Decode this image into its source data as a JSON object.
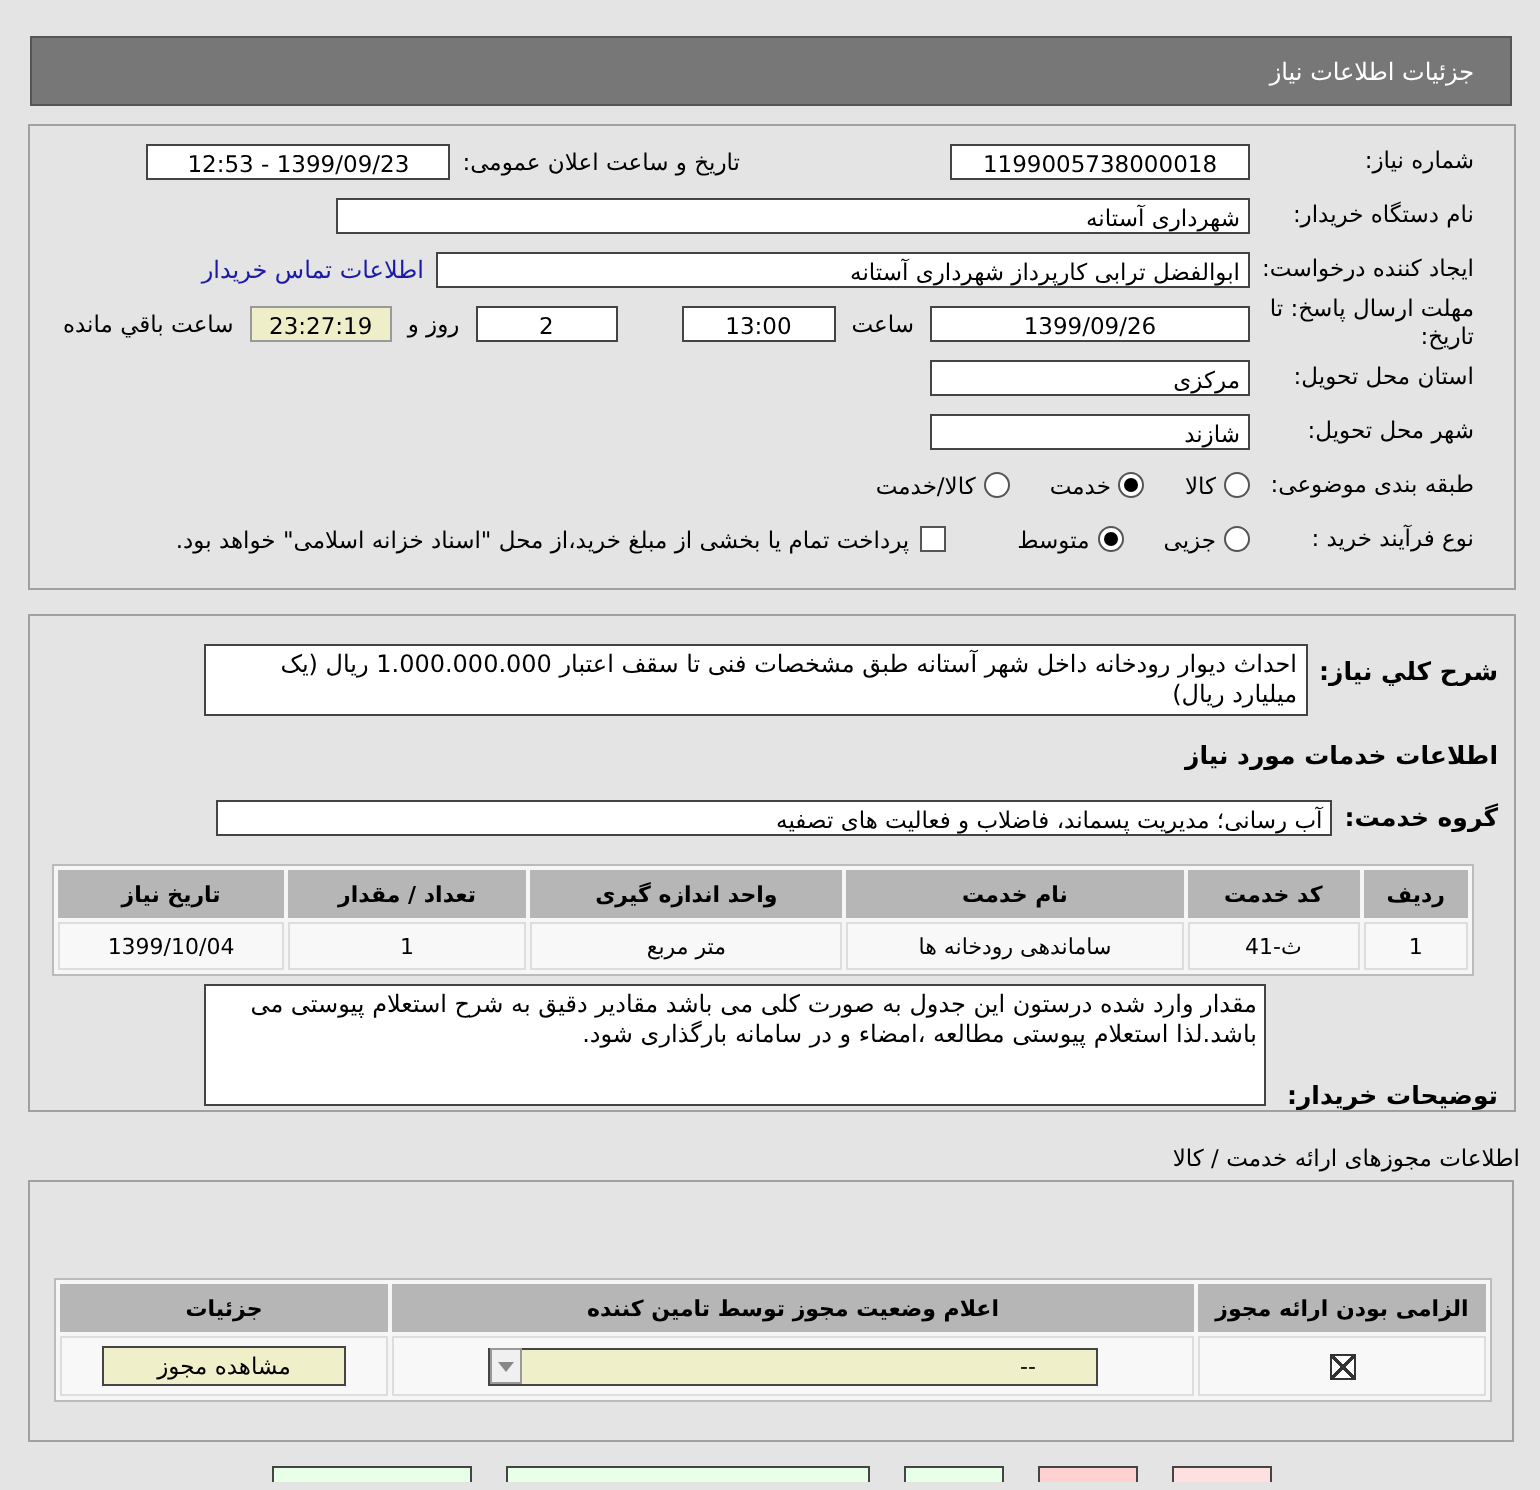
{
  "title": "جزئیات اطلاعات نیاز",
  "need_number": {
    "label": "شماره نیاز:",
    "value": "1199005738000018"
  },
  "announce_date": {
    "label": "تاریخ و ساعت اعلان عمومی:",
    "value": "1399/09/23 - 12:53"
  },
  "buyer": {
    "label": "نام دستگاه خریدار:",
    "value": "شهرداری آستانه"
  },
  "creator": {
    "label": "ایجاد کننده درخواست:",
    "value": "ابوالفضل  ترابی  کارپرداز  شهرداری آستانه",
    "link": "اطلاعات تماس خریدار"
  },
  "deadline": {
    "label": "مهلت ارسال پاسخ: تا تاریخ:",
    "date": "1399/09/26",
    "time_label": "ساعت",
    "time": "13:00",
    "days": "2",
    "days_label": "روز و",
    "remaining": "23:27:19",
    "remaining_label": "ساعت باقي مانده"
  },
  "province": {
    "label": "استان محل تحویل:",
    "value": "مرکزی"
  },
  "city": {
    "label": "شهر محل تحویل:",
    "value": "شازند"
  },
  "category": {
    "label": "طبقه بندی موضوعی:",
    "options": [
      {
        "label": "کالا",
        "selected": false
      },
      {
        "label": "خدمت",
        "selected": true
      },
      {
        "label": "کالا/خدمت",
        "selected": false
      }
    ]
  },
  "process": {
    "label": "نوع فرآیند خرید :",
    "options": [
      {
        "label": "جزیی",
        "selected": false
      },
      {
        "label": "متوسط",
        "selected": true
      }
    ],
    "treasury": {
      "label": "پرداخت تمام یا بخشی از مبلغ خرید،از محل \"اسناد خزانه اسلامی\" خواهد بود.",
      "checked": false
    }
  },
  "description": {
    "label": "شرح کلي نياز:",
    "value": "احداث دیوار رودخانه داخل شهر آستانه طبق مشخصات فنی تا سقف اعتبار 1.000.000.000 ریال (یک میلیارد ریال)"
  },
  "services_heading": "اطلاعات خدمات مورد نیاز",
  "service_group": {
    "label": "گروه خدمت:",
    "value": "آب رسانی؛ مدیریت پسماند، فاضلاب و فعالیت های تصفیه"
  },
  "services_table": {
    "columns": [
      "ردیف",
      "کد خدمت",
      "نام خدمت",
      "واحد اندازه گیری",
      "تعداد / مقدار",
      "تاریخ نیاز"
    ],
    "rows": [
      [
        "1",
        "ث-41",
        "ساماندهی رودخانه ها",
        "متر مربع",
        "1",
        "1399/10/04"
      ]
    ]
  },
  "buyer_notes": {
    "label": "توضیحات خریدار:",
    "value": "مقدار وارد شده درستون این جدول به صورت کلی می باشد مقادیر دقیق به شرح استعلام پیوستی می باشد.لذا استعلام پیوستی مطالعه ،امضاء و در سامانه بارگذاری شود."
  },
  "licenses": {
    "heading": "اطلاعات مجوزهای ارائه خدمت / کالا",
    "columns": [
      "الزامی بودن ارائه مجوز",
      "اعلام وضعیت مجوز توسط تامین کننده",
      "جزئیات"
    ],
    "rows": [
      {
        "required": true,
        "status": "--",
        "button": "مشاهده مجوز"
      }
    ]
  },
  "bottom_buttons": [
    {
      "color": "#ffe0e0"
    },
    {
      "color": "#ffd0d0"
    },
    {
      "color": "#e8ffe8"
    },
    {
      "color": "#e8ffe8"
    },
    {
      "color": "#e8ffe8"
    }
  ]
}
